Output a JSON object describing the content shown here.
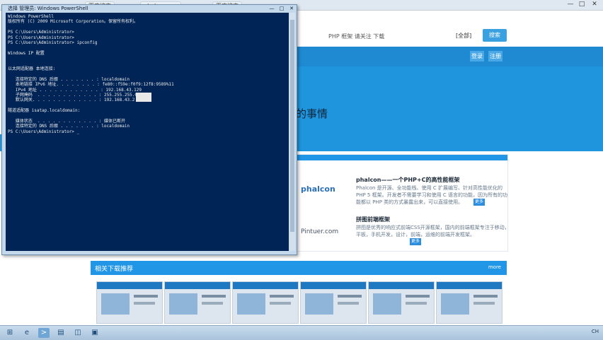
{
  "browser": {
    "tabs": [
      "百度搜索",
      "phalcon.xxx",
      "百度搜索"
    ],
    "window_controls": [
      "—",
      "□",
      "✕"
    ]
  },
  "page": {
    "search_text": "PHP 框架 请关注 下载",
    "search_scope": "[全部]",
    "search_button": "搜索",
    "nav_buttons": [
      "登录",
      "注册"
    ],
    "hero_text": "的事情",
    "items": [
      {
        "logo": "phalcon",
        "title": "phalcon——一个PHP+C的高性能框架",
        "desc": "Phalcon 是开源、全功能栈、使用 C 扩展编写、针对高性能优化的 PHP 5 框架。开发者不需要学习和使用 C 语言的功能，因为所有的功能都以 PHP 类的方式暴露出来，可以直接使用。",
        "more": "更多"
      },
      {
        "logo": "Pintuer.com",
        "title": "拼图前端框架",
        "desc": "拼图是优秀的响应式前端CSS开源框架，国内的前端框架专注于移动，平板，手机开发，设计，前端，运维的前端开发框架。",
        "more": "更多"
      }
    ],
    "section_title": "相关下载推荐",
    "section_more": "more"
  },
  "powershell": {
    "title": "选择 管理员: Windows PowerShell",
    "controls": [
      "—",
      "□",
      "✕"
    ],
    "lines": [
      "Windows PowerShell",
      "版权所有 (C) 2009 Microsoft Corporation。保留所有权利。",
      "",
      "PS C:\\Users\\Administrator>",
      "PS C:\\Users\\Administrator>",
      "PS C:\\Users\\Administrator> ipconfig",
      "",
      "Windows IP 配置",
      "",
      "",
      "以太网适配器 本地连接:",
      "",
      "   连接特定的 DNS 后缀 . . . . . . . : localdomain",
      "   本地链接 IPv6 地址. . . . . . . . : fe80::f59e:f0f9:12f8:9589%11",
      "   IPv4 地址 . . . . . . . . . . . . : 192.168.43.129",
      "   子网掩码  . . . . . . . . . . . . : 255.255.255.0",
      "   默认网关. . . . . . . . . . . . . : 192.168.43.2",
      "",
      "隧道适配器 isatap.localdomain:",
      "",
      "   媒体状态  . . . . . . . . . . . . : 媒体已断开",
      "   连接特定的 DNS 后缀 . . . . . . . : localdomain",
      "PS C:\\Users\\Administrator> _"
    ]
  },
  "taskbar": {
    "icons": [
      "start-icon",
      "ie-icon",
      "explorer-icon",
      "powershell-icon",
      "folder-icon",
      "app-icon"
    ],
    "tray": "CH"
  }
}
